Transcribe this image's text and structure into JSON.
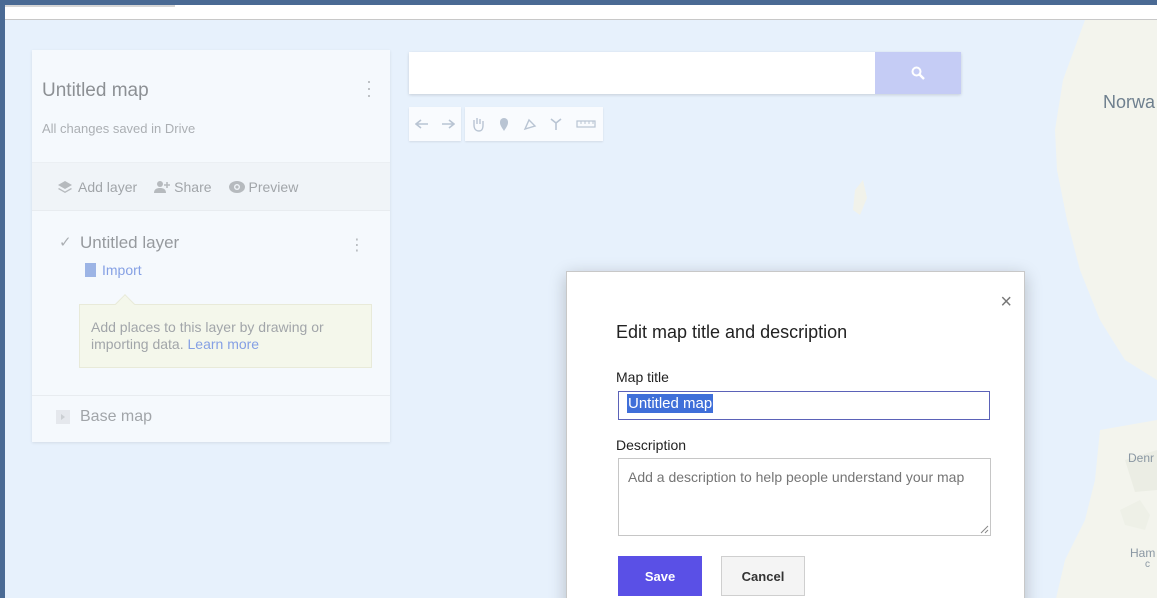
{
  "map": {
    "labels": [
      "Norwa",
      "Denr",
      "Ham",
      "c"
    ]
  },
  "panel": {
    "map_title": "Untitled map",
    "saved_status": "All changes saved in Drive",
    "actions": {
      "add_layer": "Add layer",
      "share": "Share",
      "preview": "Preview"
    },
    "layer": {
      "name": "Untitled layer",
      "import": "Import",
      "hint_text": "Add places to this layer by drawing or importing data.",
      "hint_link": "Learn more"
    },
    "base_map": "Base map"
  },
  "search": {
    "placeholder": ""
  },
  "toolbar": {
    "tools": [
      "undo-icon",
      "redo-icon",
      "hand-icon",
      "marker-icon",
      "draw-line-icon",
      "directions-icon",
      "ruler-icon"
    ]
  },
  "dialog": {
    "title": "Edit map title and description",
    "close": "×",
    "map_title_label": "Map title",
    "map_title_value": "Untitled map",
    "description_label": "Description",
    "description_placeholder": "Add a description to help people understand your map",
    "save_label": "Save",
    "cancel_label": "Cancel"
  },
  "colors": {
    "map_water": "#e7f1fc",
    "accent": "#5a50e6",
    "search_button": "#c5ccf5",
    "link": "#4a6fd6",
    "selection": "#3f6fd9"
  }
}
